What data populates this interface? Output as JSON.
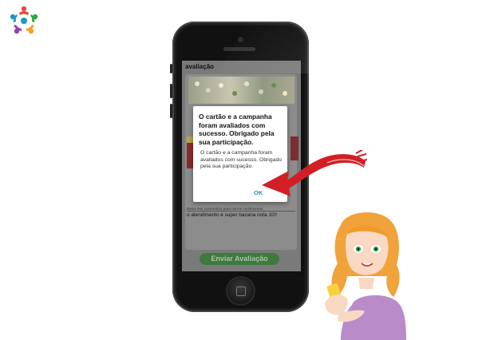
{
  "screen": {
    "title": "avaliação",
    "comment_label": "Deixe seu comentário para outros conhecerem",
    "comment_value": "o atendimento é super bacana nota 10!!",
    "submit_label": "Enviar Avaliação"
  },
  "dialog": {
    "title": "O cartão e a campanha foram avaliados com sucesso. Obrigado pela sua participação.",
    "message": "O cartão e a campanha foram avaliados com sucesso. Obrigado pela sua participação.",
    "ok_label": "OK"
  },
  "colors": {
    "accent": "#2a8fb6",
    "submit_button": "#3d7a3d",
    "arrow": "#d21f26",
    "phone_body": "#111111"
  },
  "icons": [
    "brand-logo-icon",
    "home-button-icon",
    "pointing-arrow-icon",
    "woman-with-phone-illustration"
  ]
}
